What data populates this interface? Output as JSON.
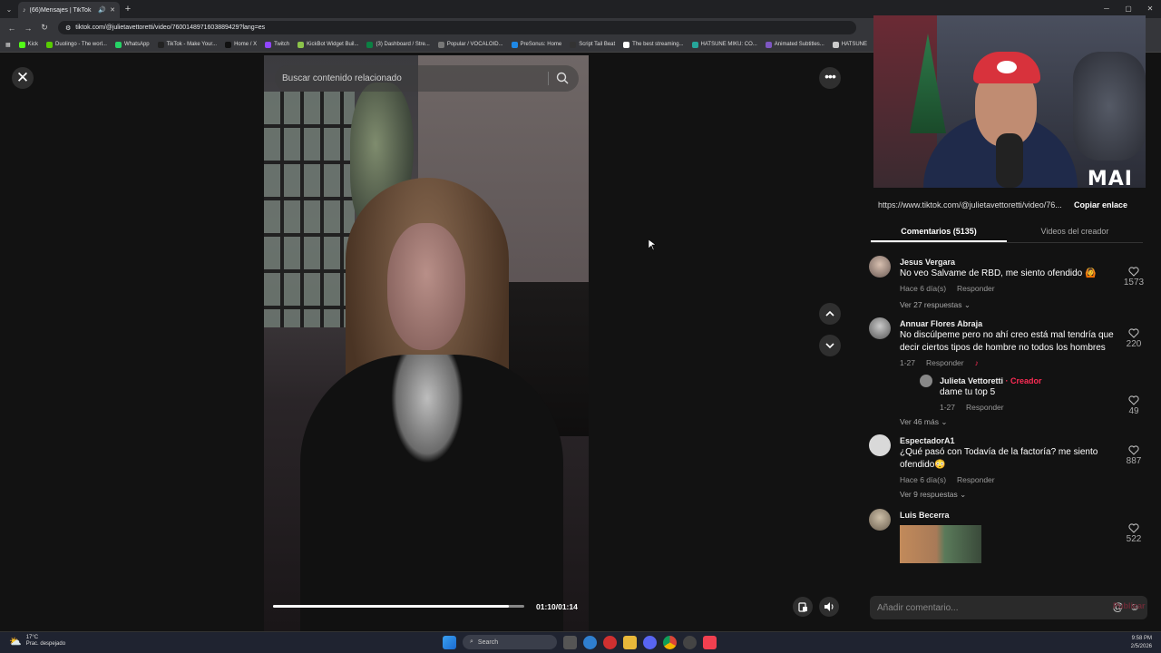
{
  "browser": {
    "tab_title": "(66)Mensajes | TikTok",
    "url": "tiktok.com/@julietavettoretti/video/7600148971603889429?lang=es",
    "bookmarks": [
      "Kick",
      "Duolingo - The worl...",
      "WhatsApp",
      "TikTok - Make Your...",
      "Home / X",
      "Twitch",
      "KickBot Widget Buil...",
      "(3) Dashboard / Stre...",
      "Popular / VOCALOID...",
      "PreSonus: Home",
      "Script Tail Beat",
      "The best streaming...",
      "HATSUNE MIKU: CO...",
      "Animated Subtitles...",
      "HATSUNE"
    ]
  },
  "video": {
    "search_placeholder": "Buscar contenido relacionado",
    "time": "01:10/01:14",
    "progress": 0.94
  },
  "webcam": {
    "logo": "MAI"
  },
  "panel": {
    "link_url": "https://www.tiktok.com/@julietavettoretti/video/76...",
    "copy_label": "Copiar enlace",
    "tab_comments": "Comentarios (5135)",
    "tab_creator": "Videos del creador",
    "input_placeholder": "Añadir comentario...",
    "publish_label": "Publicar"
  },
  "comments": [
    {
      "user": "Jesus Vergara",
      "text": "No veo Salvame de RBD, me siento ofendido 🙆",
      "date": "Hace 6 día(s)",
      "reply": "Responder",
      "likes": "1573",
      "more": "Ver 27 respuestas ⌄"
    },
    {
      "user": "Annuar Flores Abraja",
      "text": "No discúlpeme pero no ahí creo está mal tendría que decir ciertos tipos de hombre no todos los hombres",
      "date": "1-27",
      "reply": "Responder",
      "likes": "220"
    },
    {
      "user": "Julieta Vettoretti",
      "creator_tag": "· Creador",
      "text": "dame tu top 5",
      "date": "1-27",
      "reply": "Responder",
      "likes": "49",
      "more": "Ver 46 más ⌄"
    },
    {
      "user": "EspectadorA1",
      "text": "¿Qué pasó con Todavía de la factoría? me siento ofendido😳",
      "date": "Hace 6 día(s)",
      "reply": "Responder",
      "likes": "887",
      "more": "Ver 9 respuestas ⌄"
    },
    {
      "user": "Luis Becerra",
      "likes": "522"
    }
  ],
  "taskbar": {
    "temp": "17°C",
    "weather": "Prac. despejado",
    "search": "Search",
    "time": "9:58 PM",
    "date": "2/5/2026"
  },
  "colors": {
    "accent": "#fe2c55",
    "bg": "#121212"
  }
}
